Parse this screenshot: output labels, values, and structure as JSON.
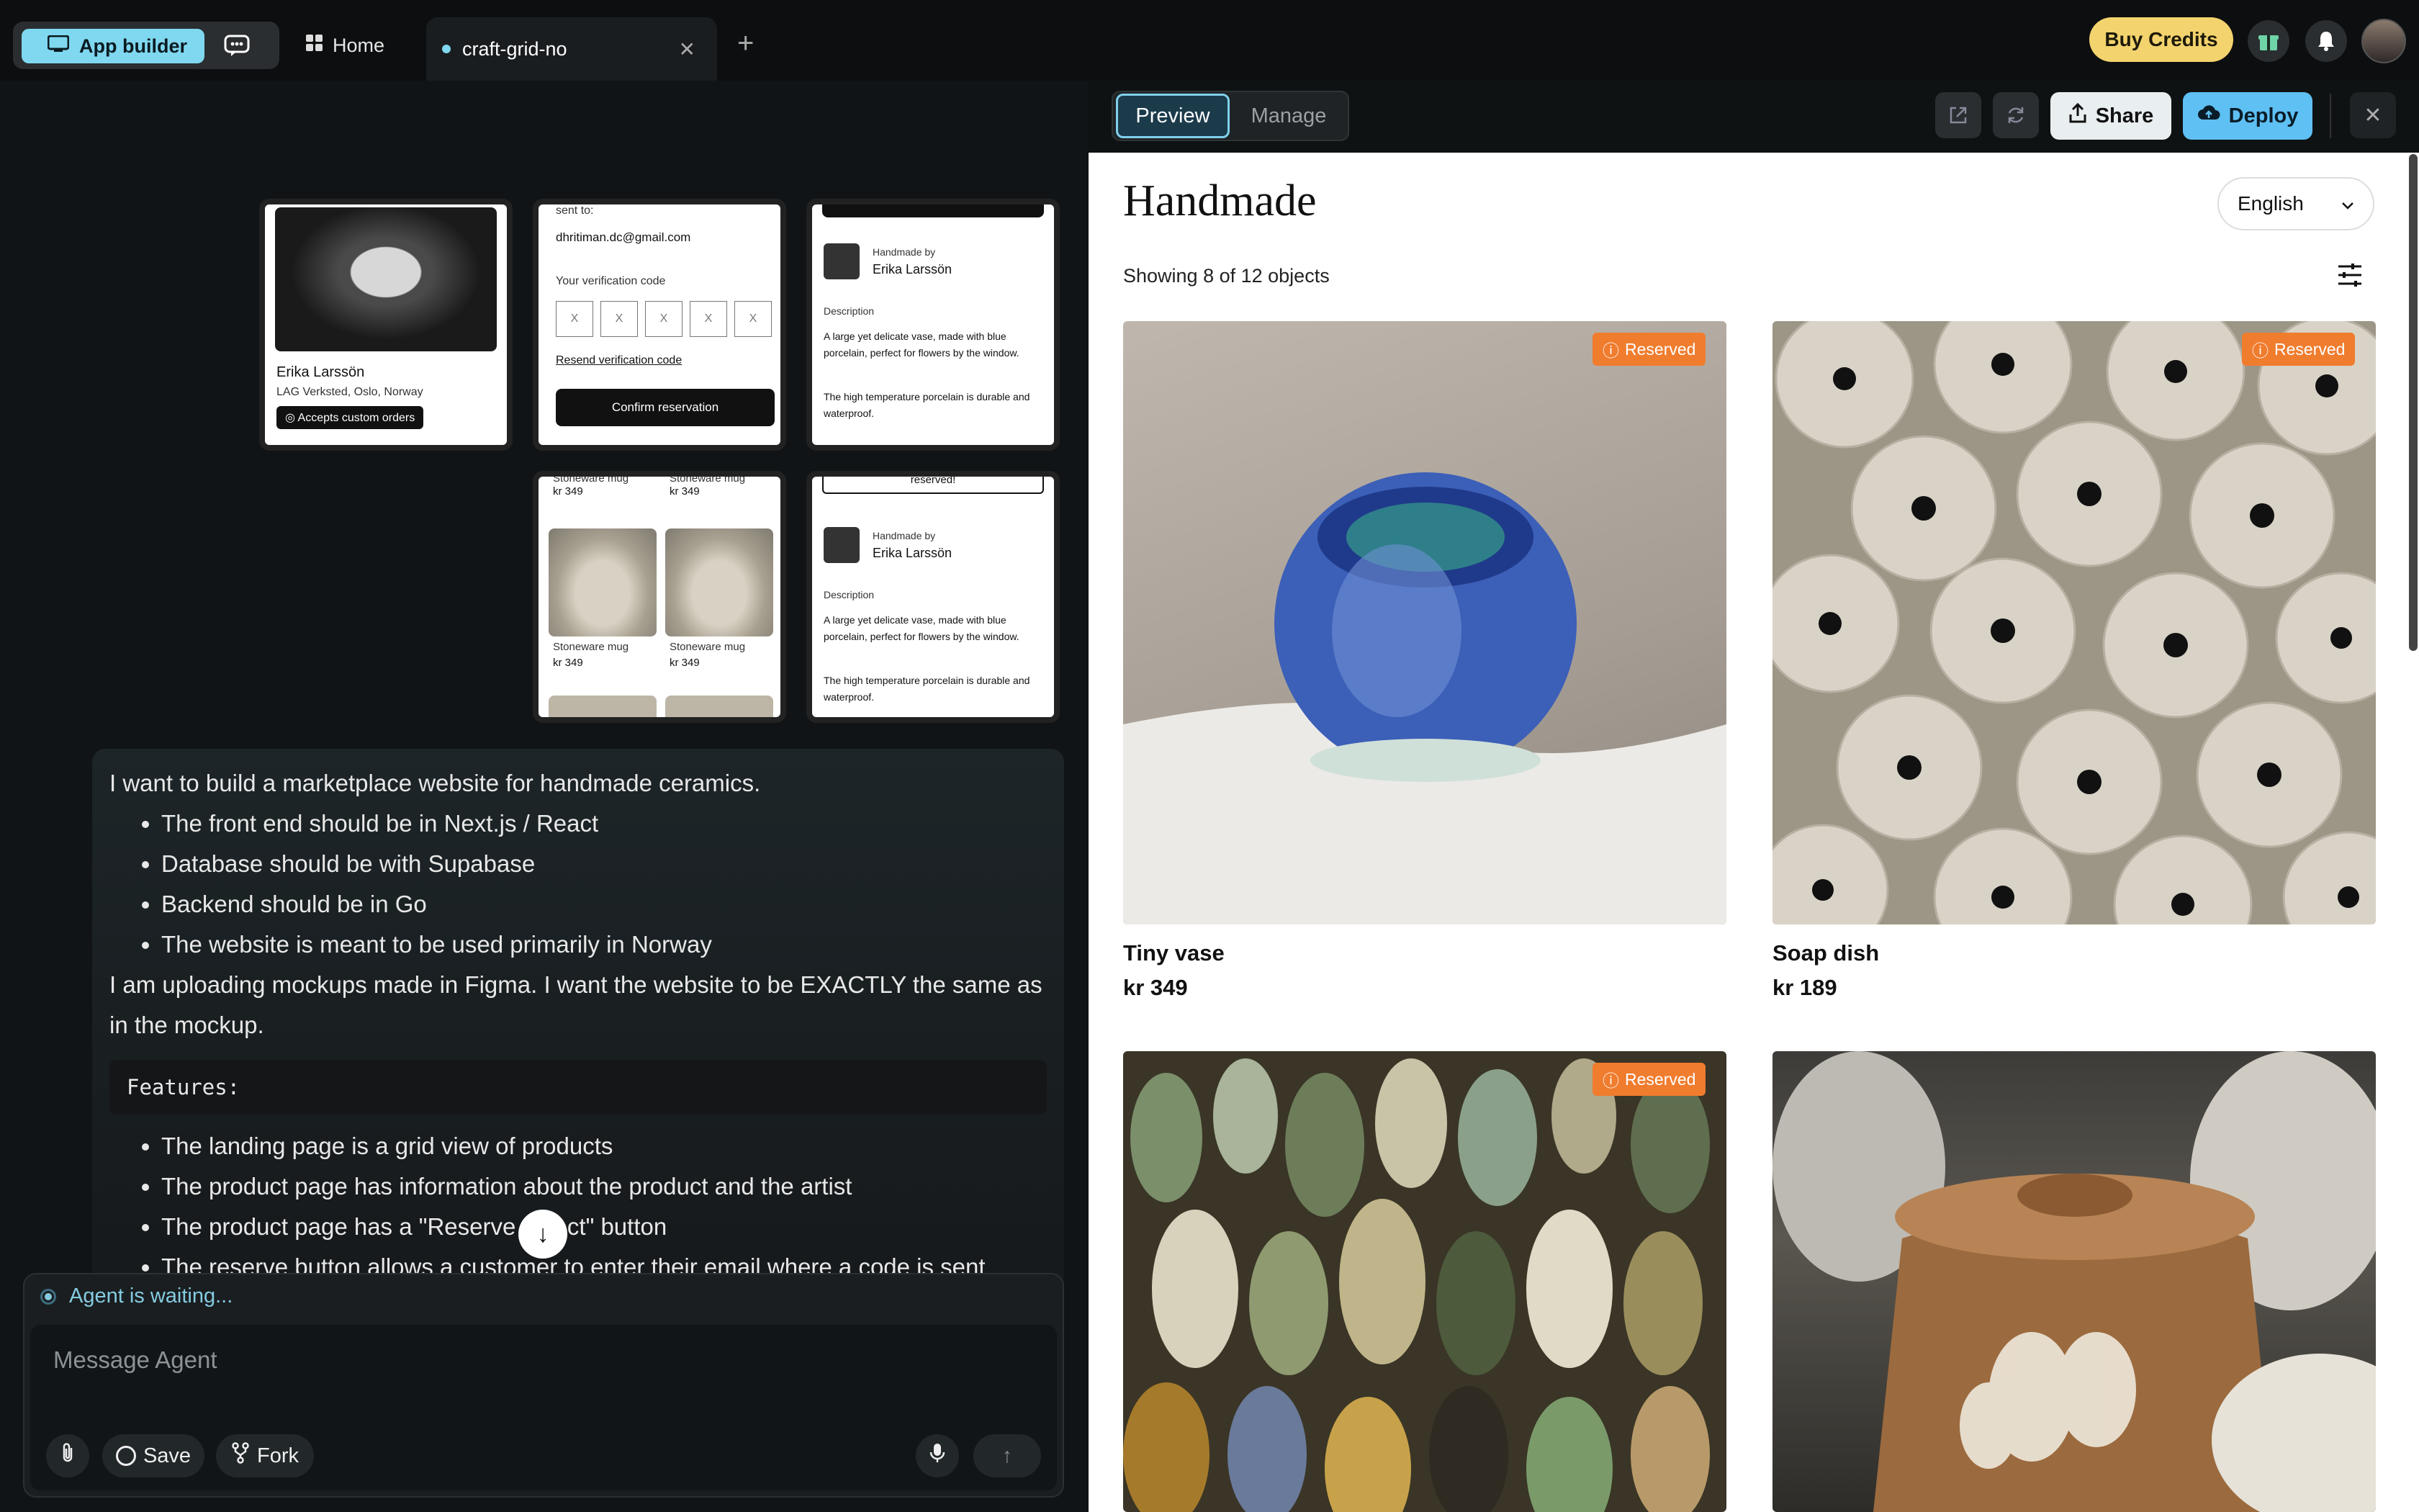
{
  "topbar": {
    "app_builder_label": "App builder",
    "home_tab": "Home",
    "project_tab": "craft-grid-no",
    "buy_credits": "Buy Credits"
  },
  "mockups": {
    "artist_name": "Erika Larssön",
    "artist_location": "LAG Verksted, Oslo, Norway",
    "custom_orders_badge": "Accepts custom orders",
    "verify_sent_label": "sent to:",
    "verify_email": "dhritiman.dc@gmail.com",
    "verify_code_label": "Your verification code",
    "verify_digit_placeholder": "X",
    "resend_code": "Resend verification code",
    "confirm_reservation": "Confirm reservation",
    "handmade_by": "Handmade by",
    "description_label": "Description",
    "desc_1": "A large yet delicate vase, made with blue porcelain, perfect for flowers by the window.",
    "desc_2": "The high temperature porcelain is durable and waterproof.",
    "mug_name": "Stoneware mug",
    "mug_price": "kr 349",
    "reserved_partial": "reserved!"
  },
  "chat": {
    "intro": "I want to build a marketplace website for handmade ceramics.",
    "bullets": [
      "The front end should be in Next.js / React",
      "Database should be with Supabase",
      "Backend should be in Go",
      "The website is meant to be used primarily in Norway"
    ],
    "para": "I am uploading mockups made in Figma. I want the website to be EXACTLY the same as in the mockup.",
    "code": "Features:",
    "features": [
      "The landing page is a grid view of products",
      "The product page has information about the product and the artist",
      "The product page has a \"Reserve object\" button",
      "The reserve button allows a customer to enter their email where a code is sent"
    ]
  },
  "agent": {
    "status": "Agent is waiting...",
    "placeholder": "Message Agent",
    "save": "Save",
    "fork": "Fork"
  },
  "preview_bar": {
    "preview": "Preview",
    "manage": "Manage",
    "share": "Share",
    "deploy": "Deploy"
  },
  "site": {
    "title": "Handmade",
    "language": "English",
    "showing": "Showing 8 of 12 objects",
    "reserved_label": "Reserved",
    "products": [
      {
        "name": "Tiny vase",
        "price": "kr 349",
        "reserved": true
      },
      {
        "name": "Soap dish",
        "price": "kr 189",
        "reserved": true
      },
      {
        "name": "",
        "price": "",
        "reserved": true
      },
      {
        "name": "",
        "price": "",
        "reserved": false
      }
    ]
  },
  "colors": {
    "accent": "#7fd8ef",
    "buy_credits": "#f3d36d",
    "deploy": "#5ec0f3",
    "reserved": "#f07c2e"
  }
}
